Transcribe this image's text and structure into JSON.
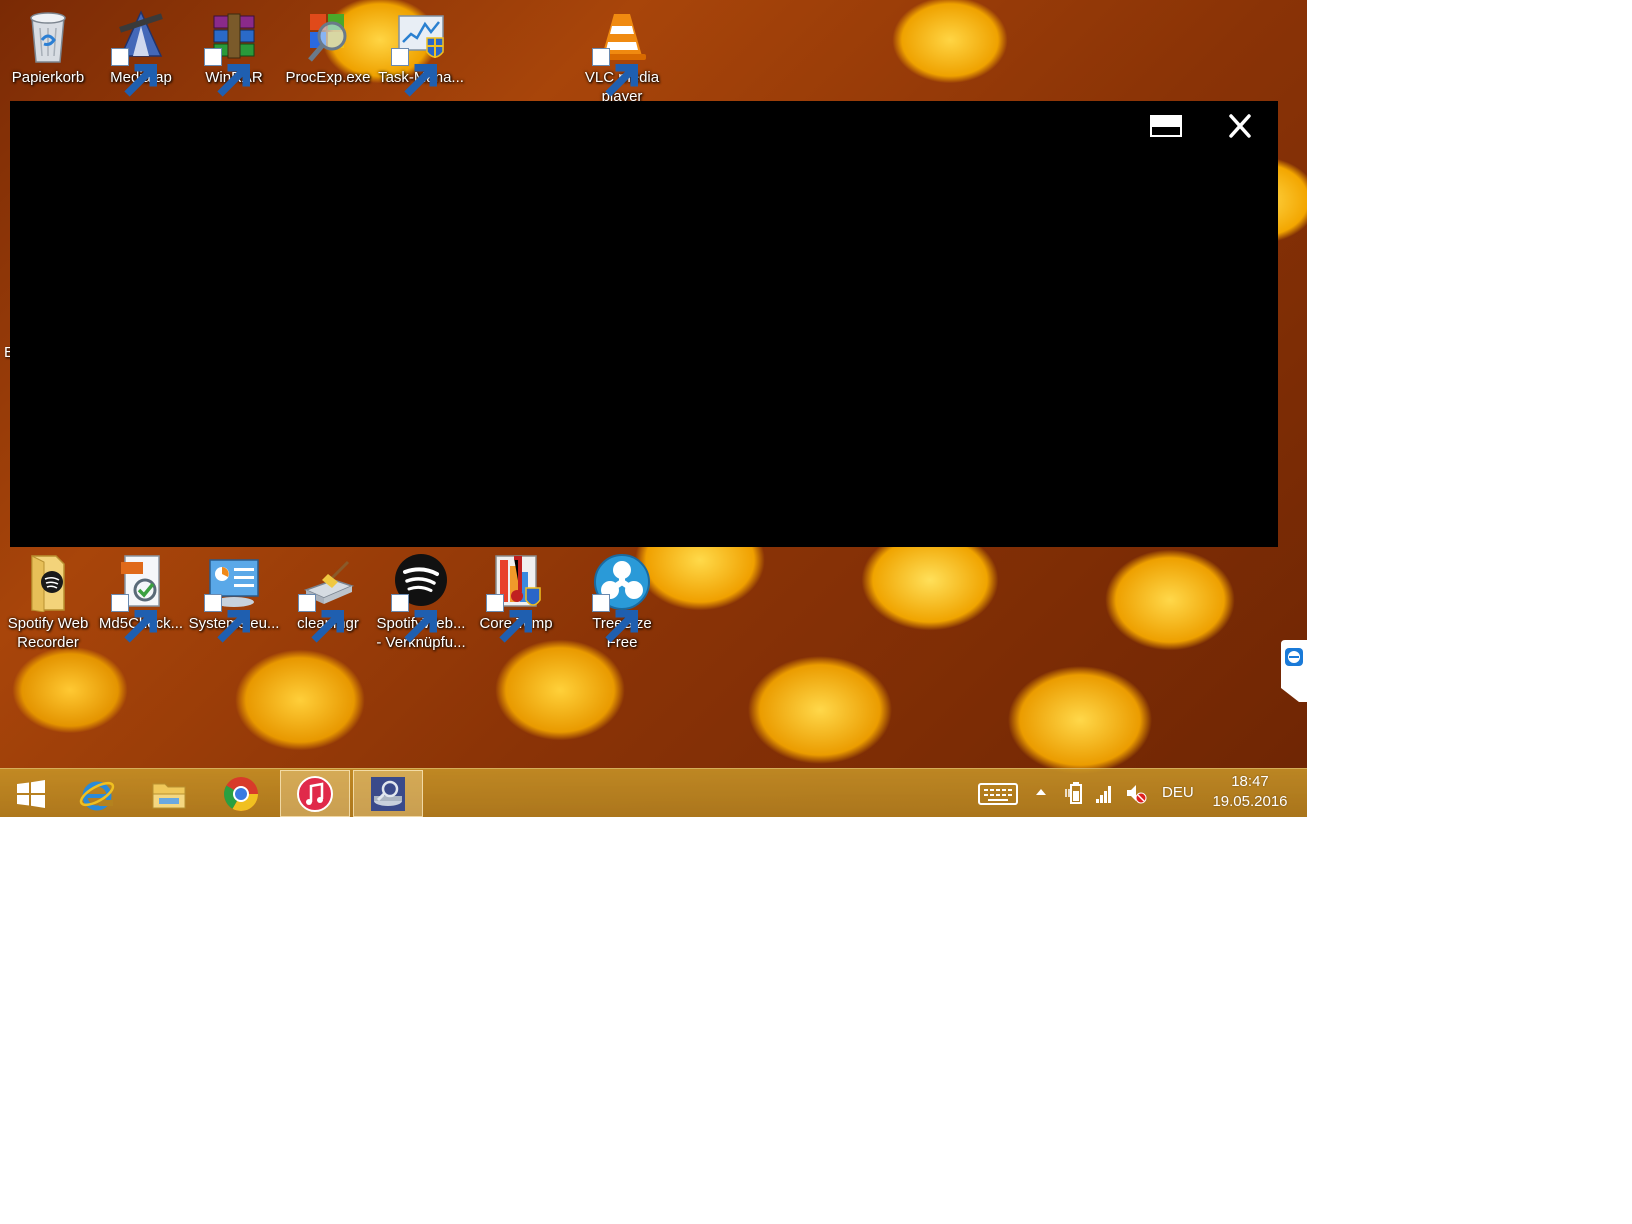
{
  "desktop": {
    "icons_top": [
      {
        "label": "Papierkorb",
        "icon": "recycle-bin-icon"
      },
      {
        "label": "Mediatap",
        "icon": "mediatap-icon"
      },
      {
        "label": "WinRAR",
        "icon": "winrar-icon"
      },
      {
        "label": "ProcExp.exe",
        "icon": "process-explorer-icon"
      },
      {
        "label": "Task-Mana...",
        "icon": "task-manager-icon"
      },
      {
        "label": "VLC media player",
        "icon": "vlc-icon"
      }
    ],
    "icons_bottom": [
      {
        "label": "Spotify Web Recorder",
        "icon": "spotify-recorder-folder-icon"
      },
      {
        "label": "Md5Check...",
        "icon": "md5check-icon"
      },
      {
        "label": "Systemsteu...",
        "icon": "control-panel-icon"
      },
      {
        "label": "cleanmgr",
        "icon": "disk-cleanup-icon"
      },
      {
        "label": "SpotifyWeb... - Verknüpfu...",
        "icon": "spotify-icon"
      },
      {
        "label": "Core Temp",
        "icon": "core-temp-icon"
      },
      {
        "label": "TreeSize Free",
        "icon": "treesize-icon"
      }
    ],
    "partial_left_text": "E"
  },
  "black_window": {
    "restore_icon": "restore-icon",
    "close_icon": "close-icon"
  },
  "taskbar": {
    "apps": [
      {
        "name": "start",
        "icon": "windows-start-icon"
      },
      {
        "name": "internet-explorer",
        "icon": "internet-explorer-icon"
      },
      {
        "name": "file-explorer",
        "icon": "file-explorer-icon"
      },
      {
        "name": "chrome",
        "icon": "chrome-icon"
      },
      {
        "name": "itunes",
        "icon": "itunes-icon",
        "active": true
      },
      {
        "name": "disk-tool",
        "icon": "disk-tool-icon",
        "active": true
      }
    ],
    "tray": {
      "language": "DEU",
      "time": "18:47",
      "date": "19.05.2016"
    }
  },
  "colors": {
    "taskbar": "#b8862a",
    "window": "#000000",
    "wallpaper_dark": "#7a2a05",
    "wallpaper_light": "#ffd233"
  }
}
